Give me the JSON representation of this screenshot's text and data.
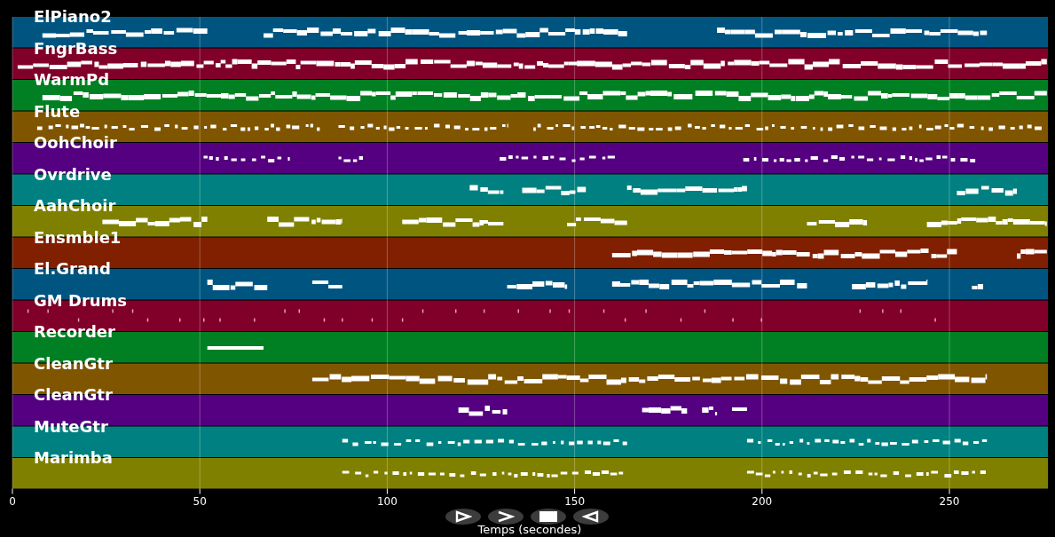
{
  "tracks": [
    {
      "name": "ElPiano2",
      "color": "#005580"
    },
    {
      "name": "FngrBass",
      "color": "#80002a"
    },
    {
      "name": "WarmPd",
      "color": "#008022"
    },
    {
      "name": "Flute",
      "color": "#805500"
    },
    {
      "name": "OohChoir",
      "color": "#550080"
    },
    {
      "name": "Ovrdrive",
      "color": "#008080"
    },
    {
      "name": "AahChoir",
      "color": "#808000"
    },
    {
      "name": "Ensmble1",
      "color": "#802000"
    },
    {
      "name": "El.Grand",
      "color": "#005580"
    },
    {
      "name": "GM Drums",
      "color": "#80002a"
    },
    {
      "name": "Recorder",
      "color": "#008022"
    },
    {
      "name": "CleanGtr",
      "color": "#805500"
    },
    {
      "name": "CleanGtr",
      "color": "#550080"
    },
    {
      "name": "MuteGtr",
      "color": "#008080"
    },
    {
      "name": "Marimba",
      "color": "#808000"
    }
  ],
  "time_axis": {
    "title": "Temps (secondes)",
    "ticks": [
      "0",
      "50",
      "100",
      "150",
      "200",
      "250"
    ]
  },
  "controls": [
    {
      "kind": "play"
    },
    {
      "kind": "next"
    },
    {
      "kind": "stop"
    },
    {
      "kind": "reverse"
    }
  ]
}
